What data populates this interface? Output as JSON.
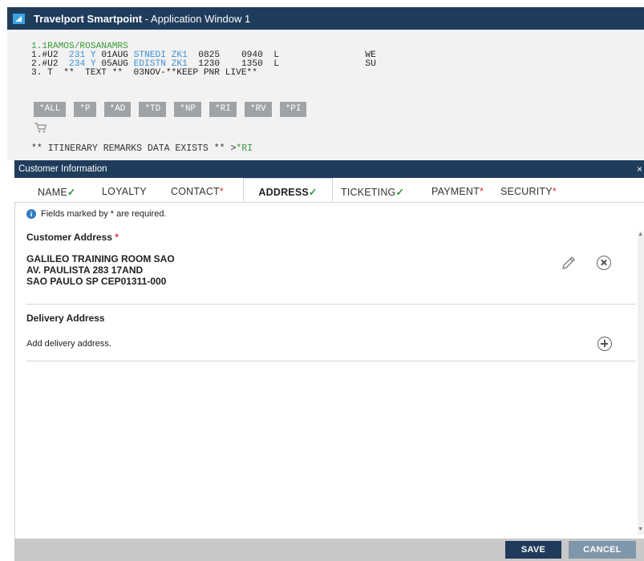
{
  "window": {
    "title_bold": "Travelport Smartpoint",
    "title_rest": " - Application Window 1"
  },
  "terminal": {
    "name_line": "1.1RAMOS/ROSANAMRS",
    "seg1": {
      "num": "1.#U2",
      "flight": "231",
      "cls": "Y",
      "date": "01AUG",
      "route": "STNEDI",
      "status": "ZK1",
      "dep": "0825",
      "arr": "0940",
      "meal": "L",
      "day": "WE"
    },
    "seg2": {
      "num": "2.#U2",
      "flight": "234",
      "cls": "Y",
      "date": "05AUG",
      "route": "EDISTN",
      "status": "ZK1",
      "dep": "1230",
      "arr": "1350",
      "meal": "L",
      "day": "SU"
    },
    "seg3": "3. T  **  TEXT **  03NOV-**KEEP PNR LIVE**",
    "commands": [
      "*ALL",
      "*P",
      "*AD",
      "*TD",
      "*NP",
      "*RI",
      "*RV",
      "*PI"
    ],
    "remarks_text": "** ITINERARY REMARKS DATA EXISTS ** >",
    "remarks_link": "*RI"
  },
  "dialog": {
    "title": "Customer Information",
    "close": "×",
    "tabs": [
      {
        "label": "NAME",
        "mark": "✓",
        "type": "ok"
      },
      {
        "label": "LOYALTY",
        "mark": "",
        "type": ""
      },
      {
        "label": "CONTACT",
        "mark": "*",
        "type": "req"
      },
      {
        "label": "ADDRESS",
        "mark": "✓",
        "type": "ok"
      },
      {
        "label": "TICKETING",
        "mark": "✓",
        "type": "ok"
      },
      {
        "label": "PAYMENT",
        "mark": "*",
        "type": "req"
      },
      {
        "label": "SECURITY",
        "mark": "*",
        "type": "req"
      }
    ],
    "active_tab": "ADDRESS",
    "notice": "Fields marked by * are required.",
    "customer_address_title": "Customer Address",
    "customer_address_req": "*",
    "address_lines": [
      "GALILEO TRAINING ROOM SAO",
      "AV. PAULISTA 283 17AND",
      "SAO PAULO SP  CEP01311-000"
    ],
    "delivery_title": "Delivery Address",
    "delivery_add_text": "Add delivery address.",
    "save_label": "SAVE",
    "cancel_label": "CANCEL"
  }
}
